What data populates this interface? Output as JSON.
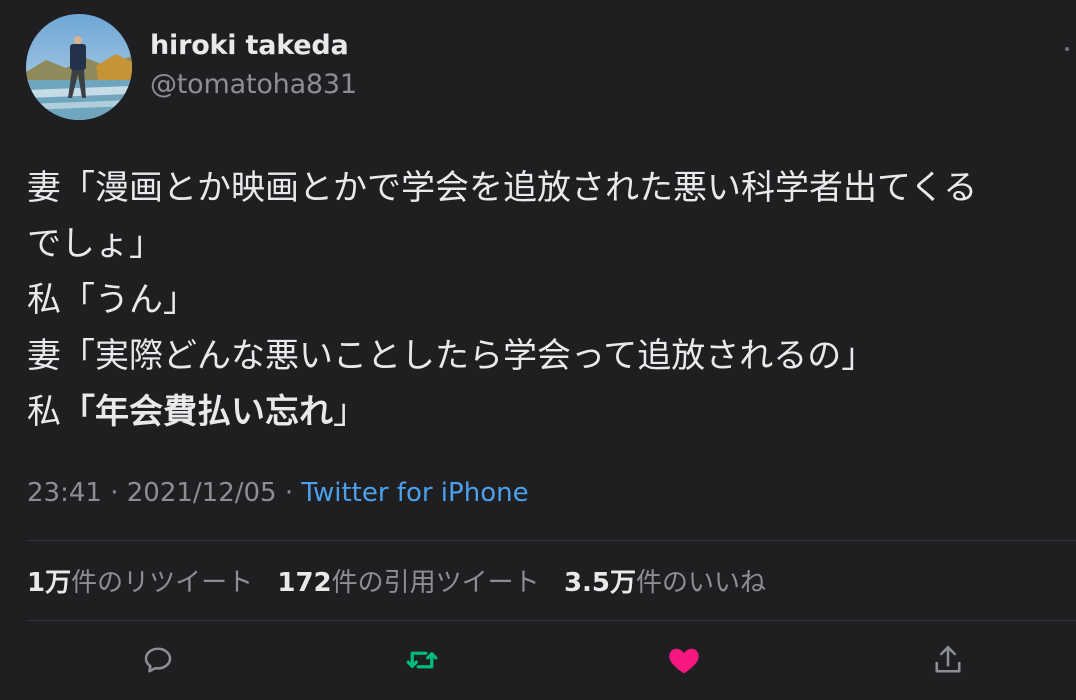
{
  "user": {
    "display_name": "hiroki takeda",
    "handle": "@tomatoha831"
  },
  "tweet": {
    "lines": [
      {
        "text": "妻「漫画とか映画とかで学会を追放された悪い科学者出てくる"
      },
      {
        "text": "でしょ」"
      },
      {
        "text": "私「うん」"
      },
      {
        "text": "妻「実際どんな悪いことしたら学会って追放されるの」"
      },
      {
        "prefix": "私",
        "open": "「",
        "bold": "年会費払い忘れ",
        "close": "」"
      }
    ]
  },
  "meta": {
    "time": "23:41",
    "separator": " · ",
    "date": "2021/12/05",
    "separator2": " · ",
    "source": "Twitter for iPhone"
  },
  "stats": {
    "retweets_num": "1万",
    "retweets_label": "件のリツイート",
    "quotes_num": "172",
    "quotes_label": "件の引用ツイート",
    "likes_num": "3.5万",
    "likes_label": "件のいいね"
  },
  "actions": {
    "reply_icon": "reply-icon",
    "retweet_icon": "retweet-icon",
    "like_icon": "heart-icon",
    "share_icon": "share-icon",
    "retweet_active_color": "#00ba7c",
    "like_active_color": "#f91880"
  },
  "colors": {
    "background": "#1f1f22",
    "text": "#e7e9ea",
    "secondary": "#8b8e92",
    "link": "#4ca0eb"
  }
}
